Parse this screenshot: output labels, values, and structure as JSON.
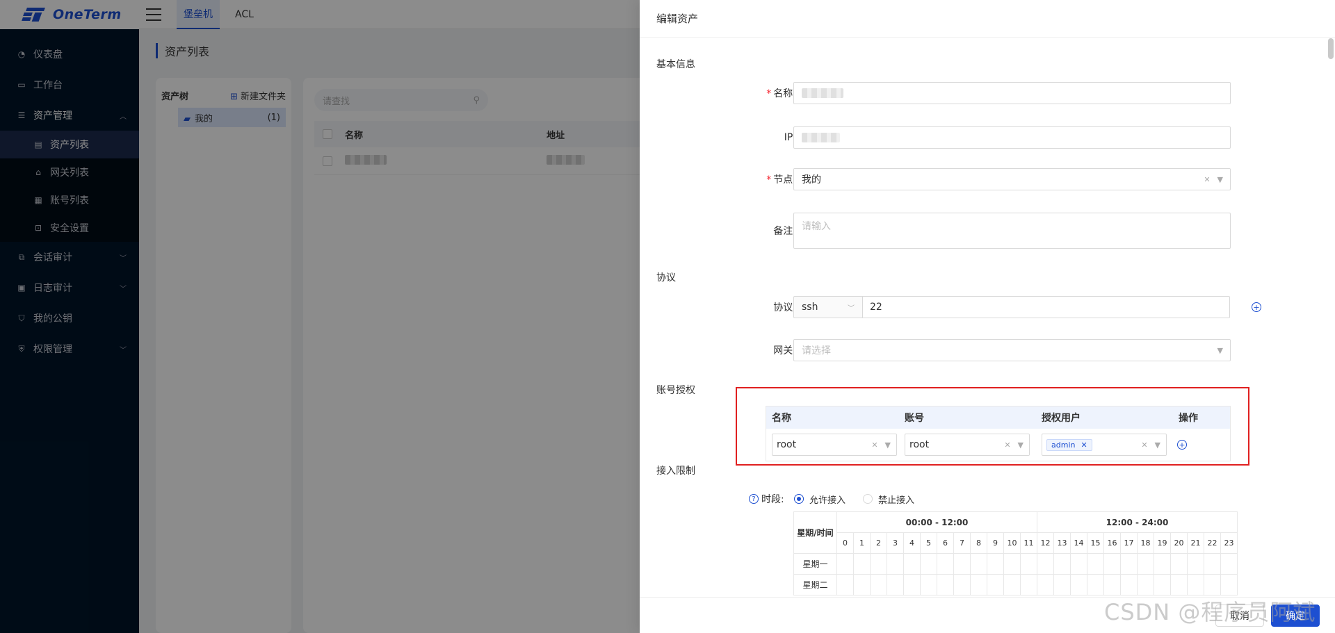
{
  "app": {
    "logo_text": "OneTerm"
  },
  "topbar": {
    "tabs": [
      {
        "label": "堡垒机"
      },
      {
        "label": "ACL"
      }
    ]
  },
  "sidebar": {
    "items": [
      {
        "label": "仪表盘"
      },
      {
        "label": "工作台"
      },
      {
        "label": "资产管理"
      },
      {
        "label": "资产列表"
      },
      {
        "label": "网关列表"
      },
      {
        "label": "账号列表"
      },
      {
        "label": "安全设置"
      },
      {
        "label": "会话审计"
      },
      {
        "label": "日志审计"
      },
      {
        "label": "我的公钥"
      },
      {
        "label": "权限管理"
      }
    ]
  },
  "main": {
    "title": "资产列表",
    "tree": {
      "title": "资产树",
      "new_folder": "新建文件夹",
      "node_label": "我的",
      "node_count": "(1)"
    },
    "search_placeholder": "请查找",
    "columns": [
      "名称",
      "地址"
    ]
  },
  "drawer": {
    "title": "编辑资产",
    "sections": {
      "basic": "基本信息",
      "protocol": "协议",
      "account": "账号授权",
      "access": "接入限制"
    },
    "fields": {
      "name_label": "名称:",
      "ip_label": "IP:",
      "node_label": "节点:",
      "node_value": "我的",
      "remark_label": "备注:",
      "remark_placeholder": "请输入",
      "protocol_label": "协议:",
      "protocol_value": "ssh",
      "port_value": "22",
      "gateway_label": "网关:",
      "gateway_placeholder": "请选择"
    },
    "account_table": {
      "headers": [
        "名称",
        "账号",
        "授权用户",
        "操作"
      ],
      "row": {
        "name": "root",
        "account": "root",
        "user_tag": "admin"
      }
    },
    "access": {
      "period_label": "时段:",
      "allow": "允许接入",
      "deny": "禁止接入",
      "corner_header": "星期/时间",
      "range_am": "00:00 - 12:00",
      "range_pm": "12:00 - 24:00",
      "hours": [
        "0",
        "1",
        "2",
        "3",
        "4",
        "5",
        "6",
        "7",
        "8",
        "9",
        "10",
        "11",
        "12",
        "13",
        "14",
        "15",
        "16",
        "17",
        "18",
        "19",
        "20",
        "21",
        "22",
        "23"
      ],
      "days": [
        "星期一",
        "星期二"
      ]
    },
    "footer": {
      "cancel": "取消",
      "confirm": "确定"
    }
  },
  "watermark": "CSDN @程序员阿斌"
}
